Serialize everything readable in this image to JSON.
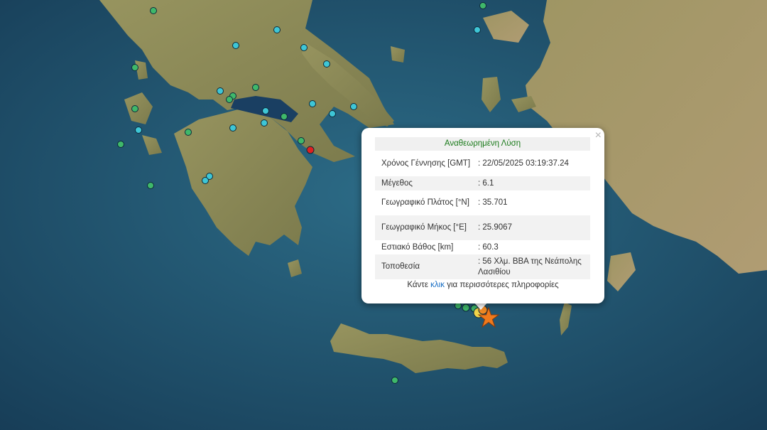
{
  "popup": {
    "title": "Αναθεωρημένη Λύση",
    "close": "×",
    "rows": [
      {
        "key": "Χρόνος Γέννησης [GMT]",
        "value": ": 22/05/2025 03:19:37.24"
      },
      {
        "key": "Μέγεθος",
        "value": ": 6.1"
      },
      {
        "key": "Γεωγραφικό Πλάτος [°N]",
        "value": ": 35.701"
      },
      {
        "key": "Γεωγραφικό Μήκος [°E]",
        "value": ": 25.9067"
      },
      {
        "key": "Εστιακό Βάθος [km]",
        "value": ": 60.3"
      },
      {
        "key": "Τοποθεσία",
        "value": ": 56 Χλμ. ΒΒΑ της Νεάπολης Λασιθίου"
      }
    ],
    "more_prefix": "Κάντε",
    "more_link": "κλικ",
    "more_suffix": "για περισσότερες πληροφορίες"
  },
  "colors": {
    "sea": "#1d4a66",
    "land": "#8a8a5c",
    "marker_cyan": "#3ec6d6",
    "marker_green": "#3fb86a",
    "marker_red": "#e02020",
    "marker_yellow": "#f2d54a",
    "marker_orange": "#f08a24",
    "epicenter_star": "#f07a1c"
  },
  "icons": {
    "epicenter": "star-icon",
    "close": "close-icon"
  }
}
